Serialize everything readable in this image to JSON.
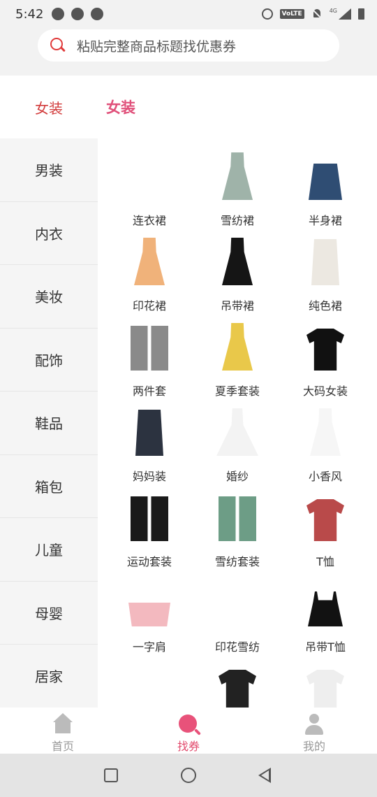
{
  "status_bar": {
    "time": "5:42",
    "network_label": "4G",
    "volte_label": "VoLTE"
  },
  "search": {
    "placeholder": "粘贴完整商品标题找优惠券"
  },
  "category": {
    "selected": "女装",
    "title": "女装"
  },
  "sidebar": {
    "items": [
      {
        "label": "男装"
      },
      {
        "label": "内衣"
      },
      {
        "label": "美妆"
      },
      {
        "label": "配饰"
      },
      {
        "label": "鞋品"
      },
      {
        "label": "箱包"
      },
      {
        "label": "儿童"
      },
      {
        "label": "母婴"
      },
      {
        "label": "居家"
      }
    ]
  },
  "grid": {
    "items": [
      {
        "label": "连衣裙",
        "icon": "dress-icon",
        "color": "#ffffff",
        "shape": "dress"
      },
      {
        "label": "雪纺裙",
        "icon": "chiffon-dress-icon",
        "color": "#9fb3a9",
        "shape": "dress"
      },
      {
        "label": "半身裙",
        "icon": "denim-skirt-icon",
        "color": "#2f4d73",
        "shape": "skirt"
      },
      {
        "label": "印花裙",
        "icon": "print-dress-icon",
        "color": "#f0b27a",
        "shape": "dress"
      },
      {
        "label": "吊带裙",
        "icon": "slip-dress-icon",
        "color": "#151515",
        "shape": "dress"
      },
      {
        "label": "纯色裙",
        "icon": "solid-dress-icon",
        "color": "#ece8e1",
        "shape": "shirt"
      },
      {
        "label": "两件套",
        "icon": "two-piece-set-icon",
        "color": "#8a8a8a",
        "shape": "set"
      },
      {
        "label": "夏季套装",
        "icon": "summer-set-icon",
        "color": "#e9c84a",
        "shape": "dress"
      },
      {
        "label": "大码女装",
        "icon": "plus-size-tee-icon",
        "color": "#111111",
        "shape": "tee"
      },
      {
        "label": "妈妈装",
        "icon": "mom-wear-icon",
        "color": "#2c3340",
        "shape": "shirt"
      },
      {
        "label": "婚纱",
        "icon": "wedding-gown-icon",
        "color": "#f3f3f3",
        "shape": "gown"
      },
      {
        "label": "小香风",
        "icon": "white-dress-icon",
        "color": "#f6f6f6",
        "shape": "dress"
      },
      {
        "label": "运动套装",
        "icon": "sport-set-icon",
        "color": "#1a1a1a",
        "shape": "set"
      },
      {
        "label": "雪纺套装",
        "icon": "chiffon-set-icon",
        "color": "#6d9d86",
        "shape": "set"
      },
      {
        "label": "T恤",
        "icon": "tshirt-icon",
        "color": "#b94a4a",
        "shape": "tee"
      },
      {
        "label": "一字肩",
        "icon": "off-shoulder-top-icon",
        "color": "#f3b9bf",
        "shape": "crop"
      },
      {
        "label": "印花雪纺",
        "icon": "print-chiffon-icon",
        "color": "#ffffff",
        "shape": "shirt"
      },
      {
        "label": "吊带T恤",
        "icon": "cami-top-icon",
        "color": "#121212",
        "shape": "cami"
      },
      {
        "label": "",
        "icon": "partial-item-icon",
        "color": "#ffffff",
        "shape": "shirt"
      },
      {
        "label": "",
        "icon": "graphic-tees-icon",
        "color": "#222222",
        "shape": "tee"
      },
      {
        "label": "",
        "icon": "white-blouse-icon",
        "color": "#eeeeee",
        "shape": "tee"
      }
    ]
  },
  "bottom_nav": {
    "items": [
      {
        "label": "首页",
        "icon": "home-icon"
      },
      {
        "label": "找券",
        "icon": "coupon-search-icon"
      },
      {
        "label": "我的",
        "icon": "user-icon"
      }
    ]
  },
  "colors": {
    "accent": "#e24a6c",
    "category_red": "#d23c3c",
    "search_icon": "#e03a3a"
  }
}
